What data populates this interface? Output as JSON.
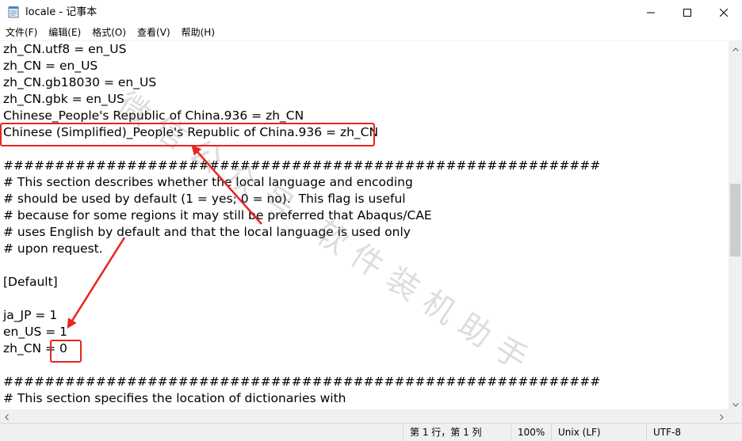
{
  "window": {
    "title": "locale - 记事本",
    "controls": {
      "minimize": "minimize",
      "maximize": "maximize",
      "close": "close"
    }
  },
  "menu": [
    {
      "label": "文件(F)"
    },
    {
      "label": "编辑(E)"
    },
    {
      "label": "格式(O)"
    },
    {
      "label": "查看(V)"
    },
    {
      "label": "帮助(H)"
    }
  ],
  "editor": {
    "lines": [
      "zh_CN.utf8 = en_US",
      "zh_CN = en_US",
      "zh_CN.gb18030 = en_US",
      "zh_CN.gbk = en_US",
      "Chinese_People's Republic of China.936 = zh_CN",
      "Chinese (Simplified)_People's Republic of China.936 = zh_CN",
      "",
      "##########################################################",
      "# This section describes whether the local language and encoding",
      "# should be used by default (1 = yes; 0 = no).  This flag is useful",
      "# because for some regions it may still be preferred that Abaqus/CAE",
      "# uses English by default and that the local language is used only",
      "# upon request.",
      "",
      "[Default]",
      "",
      "ja_JP = 1",
      "en_US = 1",
      "zh_CN = 0",
      "",
      "##########################################################",
      "# This section specifies the location of dictionaries with"
    ]
  },
  "status": {
    "position": "第 1 行，第 1 列",
    "zoom": "100%",
    "line_ending": "Unix (LF)",
    "encoding": "UTF-8"
  },
  "annotation": {
    "watermark": "微信公众号 软件装机助手",
    "color": "#e8251f"
  }
}
